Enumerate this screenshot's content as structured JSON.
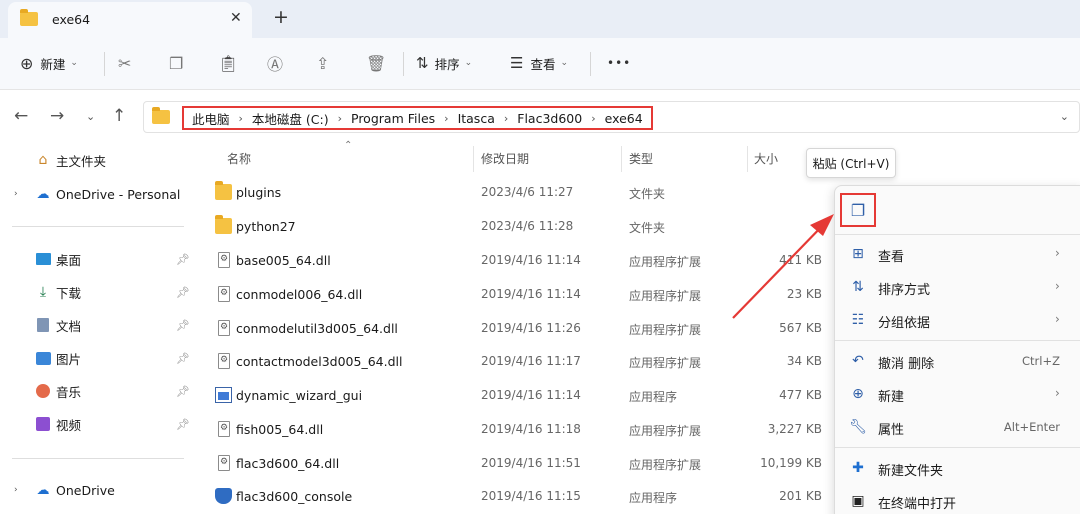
{
  "tab": {
    "title": "exe64",
    "close": "✕",
    "new_tab": "+"
  },
  "toolbar": {
    "new_label": "新建",
    "sort_label": "排序",
    "view_label": "查看",
    "more": "•••"
  },
  "address": {
    "crumbs": [
      "此电脑",
      "本地磁盘 (C:)",
      "Program Files",
      "Itasca",
      "Flac3d600",
      "exe64"
    ]
  },
  "sidebar": {
    "home": "主文件夹",
    "onedrive_personal": "OneDrive - Personal",
    "desktop": "桌面",
    "downloads": "下载",
    "documents": "文档",
    "pictures": "图片",
    "music": "音乐",
    "videos": "视频",
    "onedrive": "OneDrive"
  },
  "columns": {
    "name": "名称",
    "date": "修改日期",
    "type": "类型",
    "size": "大小"
  },
  "files": [
    {
      "name": "plugins",
      "date": "2023/4/6 11:27",
      "type": "文件夹",
      "size": "",
      "icon": "folder"
    },
    {
      "name": "python27",
      "date": "2023/4/6 11:28",
      "type": "文件夹",
      "size": "",
      "icon": "folder"
    },
    {
      "name": "base005_64.dll",
      "date": "2019/4/16 11:14",
      "type": "应用程序扩展",
      "size": "411 KB",
      "icon": "dll"
    },
    {
      "name": "conmodel006_64.dll",
      "date": "2019/4/16 11:14",
      "type": "应用程序扩展",
      "size": "23 KB",
      "icon": "dll"
    },
    {
      "name": "conmodelutil3d005_64.dll",
      "date": "2019/4/16 11:26",
      "type": "应用程序扩展",
      "size": "567 KB",
      "icon": "dll"
    },
    {
      "name": "contactmodel3d005_64.dll",
      "date": "2019/4/16 11:17",
      "type": "应用程序扩展",
      "size": "34 KB",
      "icon": "dll"
    },
    {
      "name": "dynamic_wizard_gui",
      "date": "2019/4/16 11:14",
      "type": "应用程序",
      "size": "477 KB",
      "icon": "app"
    },
    {
      "name": "fish005_64.dll",
      "date": "2019/4/16 11:18",
      "type": "应用程序扩展",
      "size": "3,227 KB",
      "icon": "dll"
    },
    {
      "name": "flac3d600_64.dll",
      "date": "2019/4/16 11:51",
      "type": "应用程序扩展",
      "size": "10,199 KB",
      "icon": "dll"
    },
    {
      "name": "flac3d600_console",
      "date": "2019/4/16 11:15",
      "type": "应用程序",
      "size": "201 KB",
      "icon": "shield"
    }
  ],
  "tooltip": "粘贴 (Ctrl+V)",
  "context_menu": {
    "view": "查看",
    "sort": "排序方式",
    "group": "分组依据",
    "undo": "撤消 删除",
    "undo_shortcut": "Ctrl+Z",
    "new": "新建",
    "properties": "属性",
    "properties_shortcut": "Alt+Enter",
    "new_folder": "新建文件夹",
    "terminal": "在终端中打开"
  },
  "colors": {
    "highlight": "#e53935",
    "accent": "#2f5fa8",
    "folder": "#f5c242"
  }
}
